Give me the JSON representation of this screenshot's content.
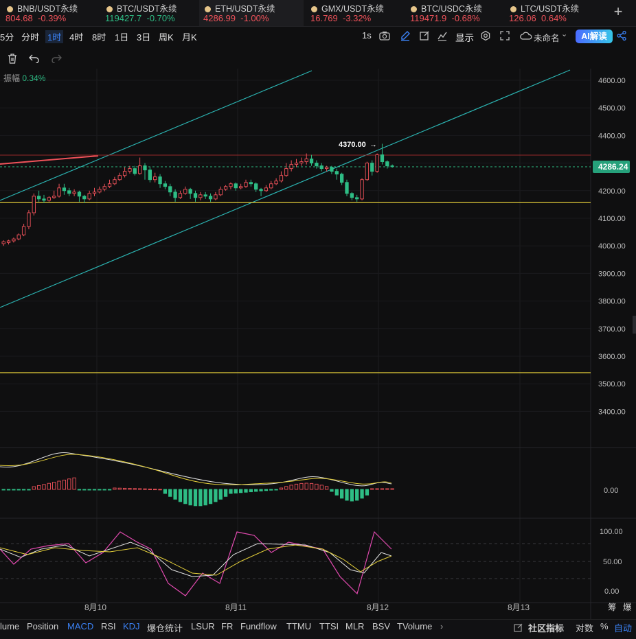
{
  "tickers": [
    {
      "symbol": "BNB/USDT永续",
      "price": "804.68",
      "change": "-0.39%",
      "dir": "down"
    },
    {
      "symbol": "BTC/USDT永续",
      "price": "119427.7",
      "change": "-0.70%",
      "dir": "up"
    },
    {
      "symbol": "ETH/USDT永续",
      "price": "4286.99",
      "change": "-1.00%",
      "dir": "down"
    },
    {
      "symbol": "GMX/USDT永续",
      "price": "16.769",
      "change": "-3.32%",
      "dir": "down"
    },
    {
      "symbol": "BTC/USDC永续",
      "price": "119471.9",
      "change": "-0.68%",
      "dir": "down"
    },
    {
      "symbol": "LTC/USDT永续",
      "price": "126.06",
      "change": "0.64%",
      "dir": "down"
    }
  ],
  "timeframes": [
    "5分",
    "分时",
    "1时",
    "4时",
    "8时",
    "1日",
    "3日",
    "周K",
    "月K"
  ],
  "selected_timeframe": "1时",
  "toolbar_right": {
    "interval": "1s",
    "display": "显示",
    "layout_name": "未命名",
    "ai_button": "AI解读"
  },
  "amplitude": {
    "label": "振幅",
    "value": "0.34%"
  },
  "price_axis": [
    "4600.00",
    "4500.00",
    "4400.00",
    "4300.00",
    "4200.00",
    "4100.00",
    "4000.00",
    "3900.00",
    "3800.00",
    "3700.00",
    "3600.00",
    "3500.00",
    "3400.00"
  ],
  "current_price": "4286.24",
  "high_marker": "4370.00",
  "macd_axis": [
    "0.00"
  ],
  "kdj_axis": [
    "100.00",
    "50.00",
    "0.00"
  ],
  "date_axis": [
    "8月10",
    "8月11",
    "8月12",
    "8月13"
  ],
  "right_corner": [
    "筹",
    "爆"
  ],
  "indicators": [
    "lume",
    "Position",
    "MACD",
    "RSI",
    "KDJ",
    "爆仓统计",
    "LSUR",
    "FR",
    "Fundflow",
    "TTMU",
    "TTSI",
    "MLR",
    "BSV",
    "TVolume"
  ],
  "selected_indicators": [
    "MACD",
    "KDJ"
  ],
  "bottom_right": {
    "community": "社区指标",
    "log": "对数",
    "percent": "%",
    "auto": "自动"
  },
  "colors": {
    "up": "#2ebd85",
    "down": "#f0525a",
    "accent": "#3b82f6",
    "channel": "#2bb3b1",
    "support": "#e6d13a"
  }
}
